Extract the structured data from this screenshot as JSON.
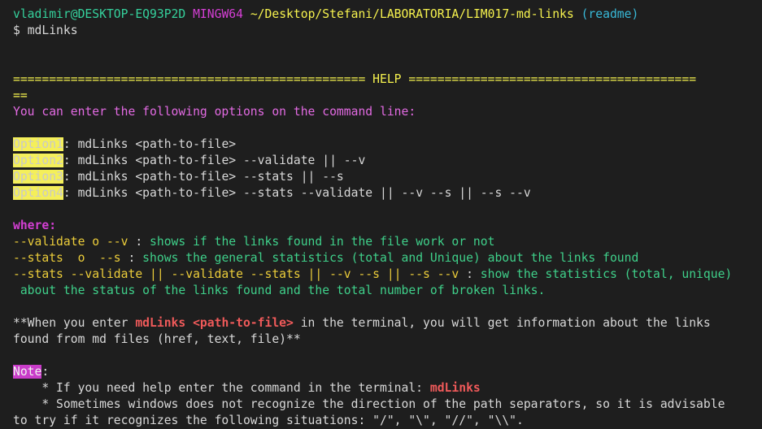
{
  "colors": {
    "background": "#1e1e1e",
    "foreground": "#d8d8d8",
    "green": "#35d19c",
    "magenta": "#d43fd4",
    "yellow": "#f6f24e",
    "cyan": "#38b9d8",
    "red": "#f05a5a",
    "highlight_yellow": "#f4ef5a",
    "highlight_magenta": "#c93cc9",
    "pink": "#e26ae2"
  },
  "prompt": {
    "user_host": "vladimir@DESKTOP-EQ93P2D",
    "shell": "MINGW64",
    "path": "~/Desktop/Stefani/LABORATORIA/LIM017-md-links",
    "branch": "(readme)",
    "symbol": "$",
    "command": "mdLinks"
  },
  "help": {
    "banner_left": "=================================================",
    "banner_title": "HELP",
    "banner_right": "========================================",
    "banner_wrap": "==",
    "intro": "You can enter the following options on the command line:",
    "options": [
      {
        "label": "Option1",
        "separator": ": ",
        "command": "mdLinks <path-to-file>"
      },
      {
        "label": "Option2",
        "separator": ": ",
        "command": "mdLinks <path-to-file> --validate || --v"
      },
      {
        "label": "Option3",
        "separator": ": ",
        "command": "mdLinks <path-to-file> --stats || --s"
      },
      {
        "label": "Option4",
        "separator": ": ",
        "command": "mdLinks <path-to-file> --stats --validate || --v --s || --s --v"
      }
    ],
    "where_label": "where:",
    "where_entries": [
      {
        "flags": "--validate o --v ",
        "colon": ": ",
        "description": "shows if the links found in the file work or not"
      },
      {
        "flags": "--stats  o  --s ",
        "colon": ": ",
        "description": "shows the general statistics (total and Unique) about the links found"
      },
      {
        "flags": "--stats --validate || --validate --stats || --v --s || --s --v ",
        "colon": ": ",
        "description": "show the statistics (total, unique)",
        "description_cont": " about the status of the links found and the total number of broken links."
      }
    ],
    "paragraph": {
      "prefix": "**When you enter ",
      "emphasis": "mdLinks <path-to-file>",
      "suffix": " in the terminal, you will get information about the links",
      "line2": "found from md files (href, text, file)**"
    },
    "note": {
      "label": "Note",
      "colon": ":",
      "bullets": [
        {
          "prefix": "    * If you need help enter the command in the terminal: ",
          "emphasis": "mdLinks"
        },
        {
          "line1": "    * Sometimes windows does not recognize the direction of the path separators, so it is advisable",
          "line2": "to try if it recognizes the following situations: \"/\", \"\\\", \"//\", \"\\\\\"."
        }
      ]
    }
  }
}
